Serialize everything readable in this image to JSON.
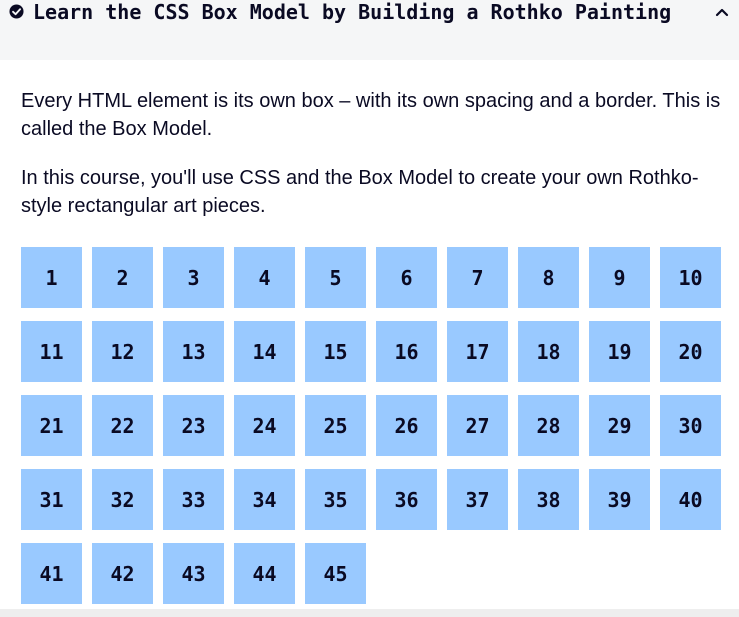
{
  "header": {
    "title": "Learn the CSS Box Model by Building a Rothko Painting"
  },
  "description": {
    "paragraph1": "Every HTML element is its own box – with its own spacing and a border. This is called the Box Model.",
    "paragraph2": "In this course, you'll use CSS and the Box Model to create your own Rothko-style rectangular art pieces."
  },
  "steps": [
    "1",
    "2",
    "3",
    "4",
    "5",
    "6",
    "7",
    "8",
    "9",
    "10",
    "11",
    "12",
    "13",
    "14",
    "15",
    "16",
    "17",
    "18",
    "19",
    "20",
    "21",
    "22",
    "23",
    "24",
    "25",
    "26",
    "27",
    "28",
    "29",
    "30",
    "31",
    "32",
    "33",
    "34",
    "35",
    "36",
    "37",
    "38",
    "39",
    "40",
    "41",
    "42",
    "43",
    "44",
    "45"
  ],
  "colors": {
    "header_bg": "#f5f6f7",
    "tile_bg": "#99c9ff",
    "text": "#0a0a23"
  },
  "icons": {
    "status": "check-circle-icon",
    "collapse": "chevron-up-icon"
  }
}
